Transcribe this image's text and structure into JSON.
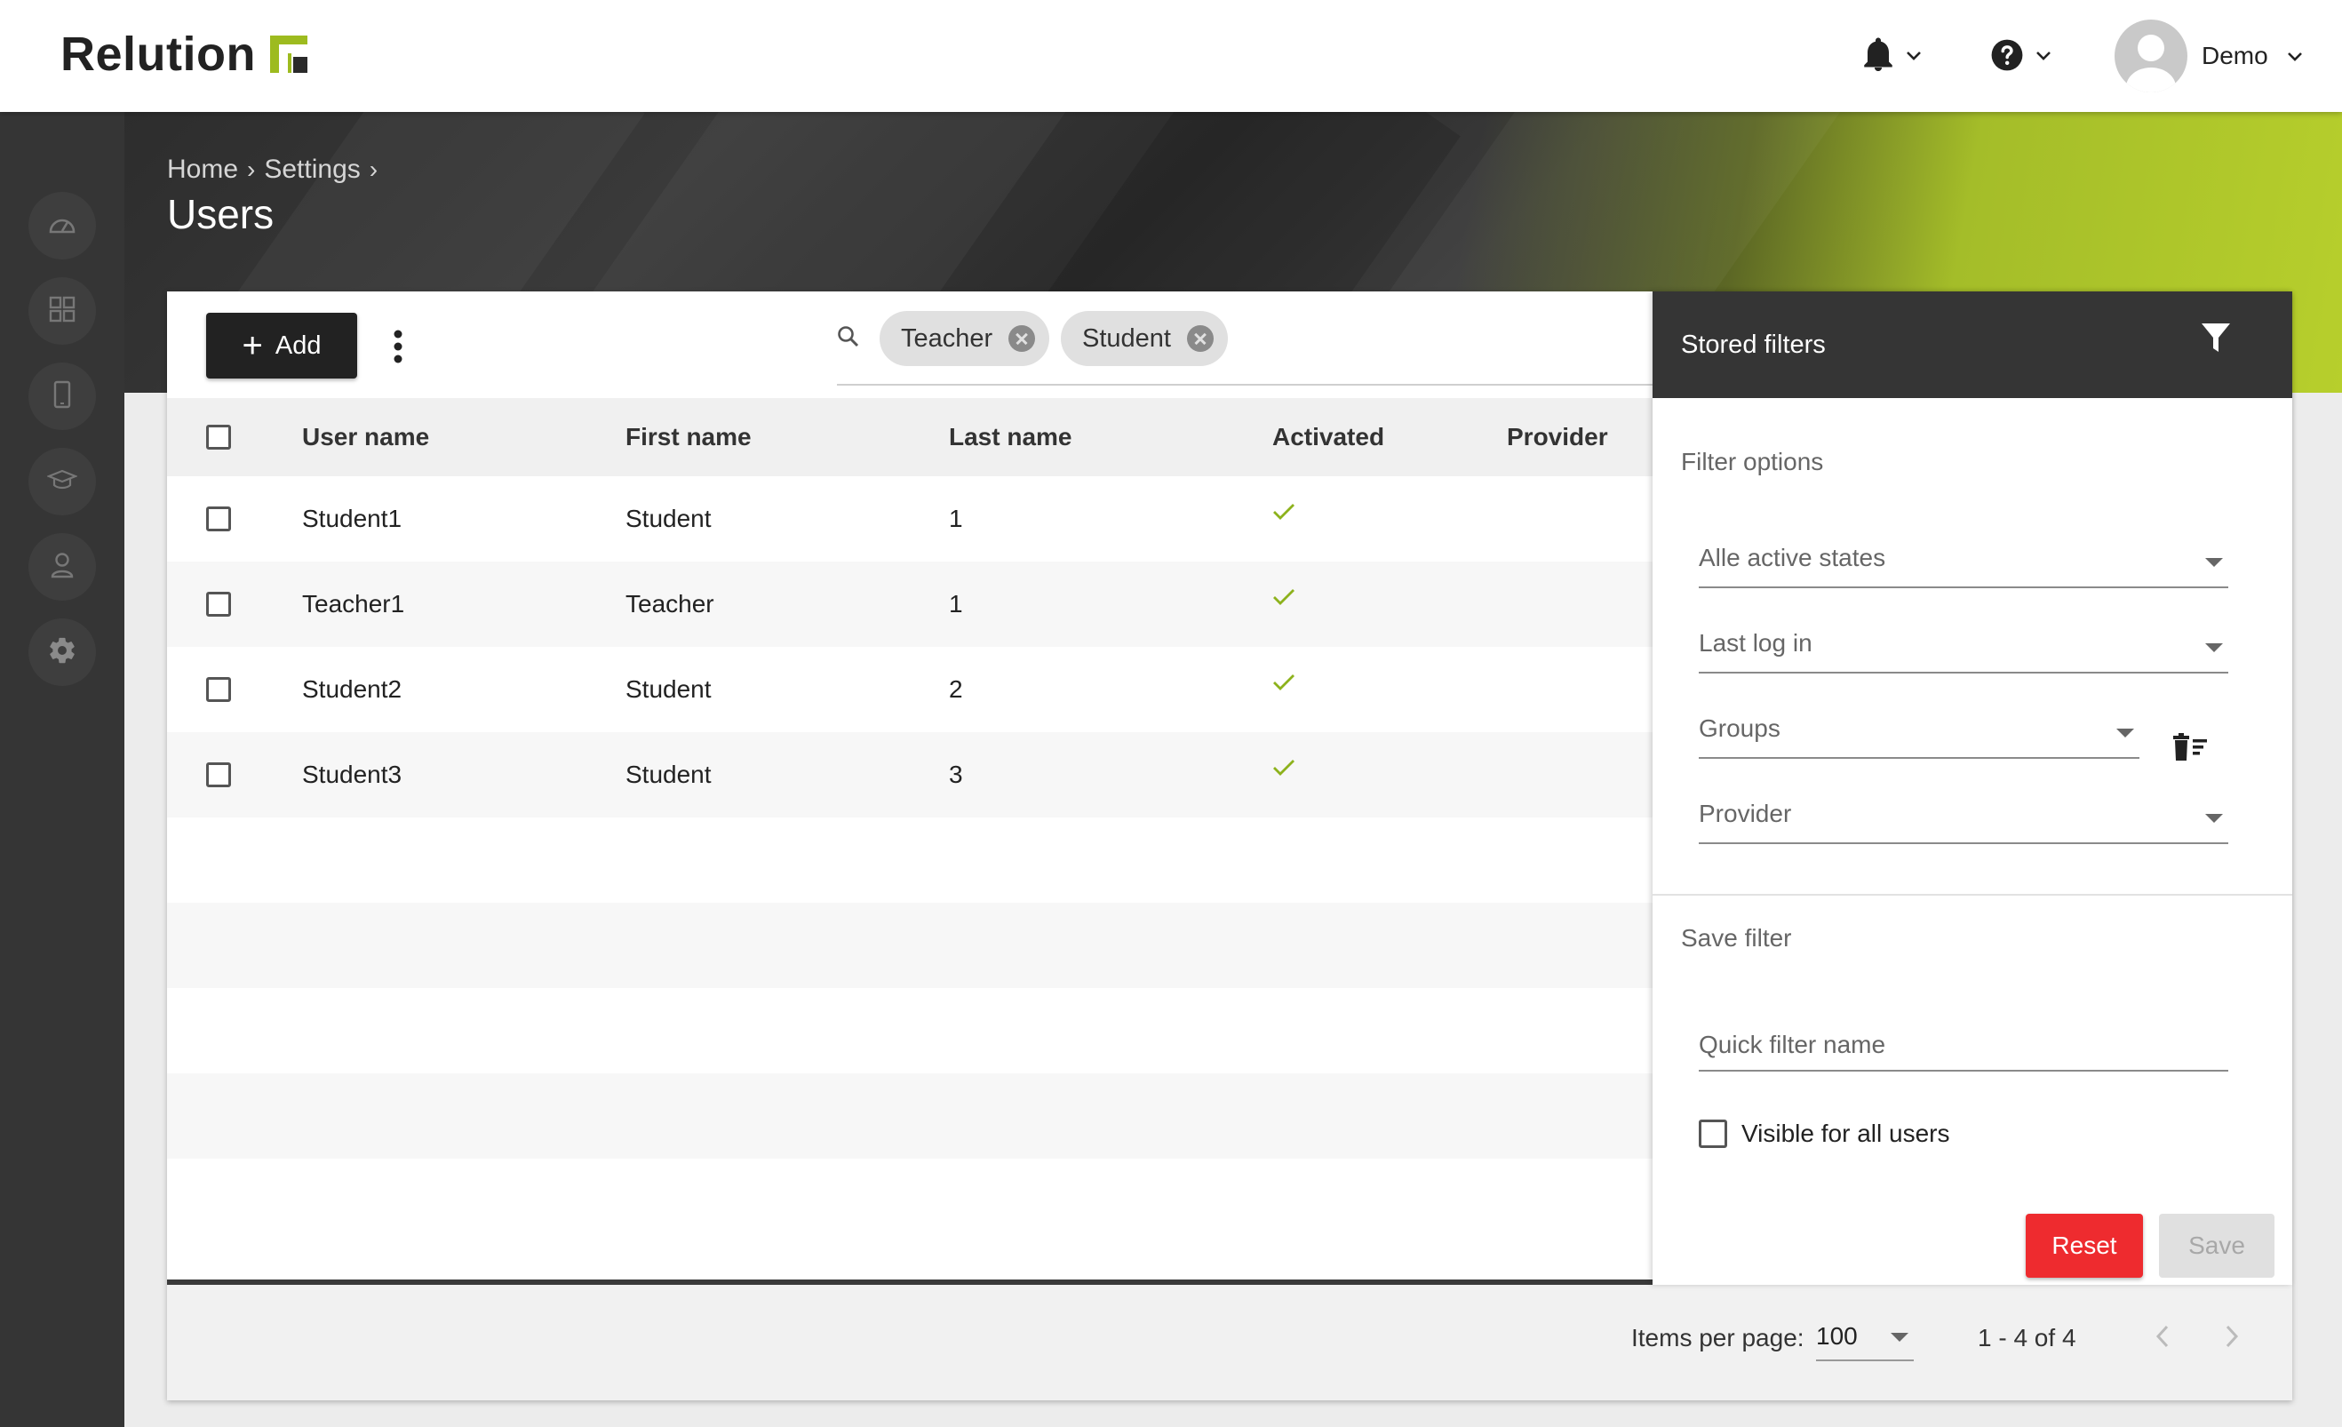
{
  "app": {
    "logo_text": "Relution",
    "brand_color": "#9dbb1f",
    "accent_red": "#ee2b2f"
  },
  "header": {
    "notifications_icon": "bell-icon",
    "help_icon": "help-circle-icon",
    "user": {
      "name": "Demo",
      "avatar_icon": "avatar-placeholder-icon"
    }
  },
  "sidebar": {
    "items": [
      {
        "icon": "dashboard-gauge-icon"
      },
      {
        "icon": "apps-grid-icon"
      },
      {
        "icon": "device-phone-icon"
      },
      {
        "icon": "education-cap-icon"
      },
      {
        "icon": "user-icon"
      },
      {
        "icon": "settings-gear-icon"
      }
    ]
  },
  "breadcrumb": {
    "items": [
      "Home",
      "Settings"
    ],
    "separator": "›"
  },
  "page": {
    "title": "Users"
  },
  "toolbar": {
    "add_label": "Add",
    "more_icon": "more-vertical-icon",
    "search_icon": "search-icon",
    "chips": [
      "Teacher",
      "Student"
    ]
  },
  "table": {
    "columns": [
      "User name",
      "First name",
      "Last name",
      "Activated",
      "Provider"
    ],
    "rows": [
      {
        "user_name": "Student1",
        "first_name": "Student",
        "last_name": "1",
        "activated": true,
        "provider": ""
      },
      {
        "user_name": "Teacher1",
        "first_name": "Teacher",
        "last_name": "1",
        "activated": true,
        "provider": ""
      },
      {
        "user_name": "Student2",
        "first_name": "Student",
        "last_name": "2",
        "activated": true,
        "provider": ""
      },
      {
        "user_name": "Student3",
        "first_name": "Student",
        "last_name": "3",
        "activated": true,
        "provider": ""
      }
    ]
  },
  "pagination": {
    "items_per_page_label": "Items per page:",
    "items_per_page": "100",
    "range": "1 - 4 of 4"
  },
  "filters": {
    "title": "Stored filters",
    "filter_options_label": "Filter options",
    "selects": {
      "active_states": "Alle active states",
      "last_login": "Last log in",
      "groups": "Groups",
      "provider": "Provider"
    },
    "save_filter_label": "Save filter",
    "quick_filter_placeholder": "Quick filter name",
    "visible_for_all_label": "Visible for all users",
    "reset_label": "Reset",
    "save_label": "Save"
  }
}
